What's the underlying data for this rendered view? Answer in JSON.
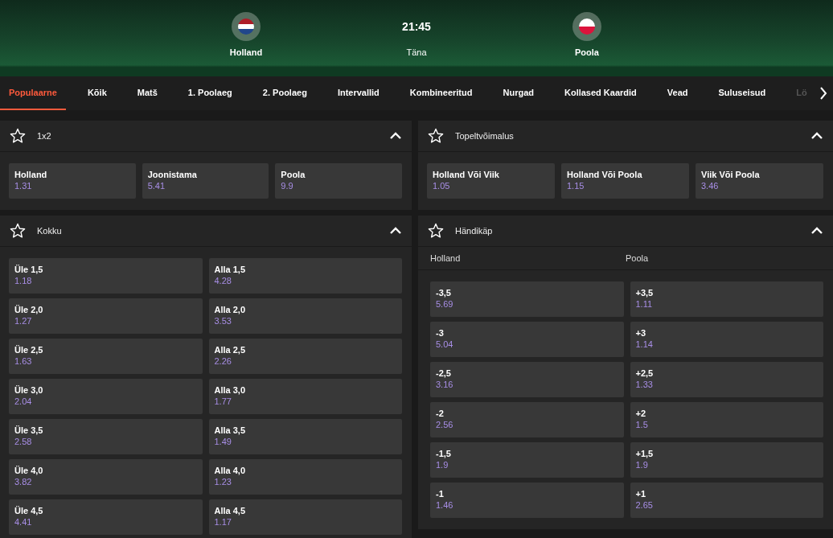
{
  "match": {
    "home": {
      "name": "Holland"
    },
    "time": "21:45",
    "day": "Täna",
    "away": {
      "name": "Poola"
    }
  },
  "tabs": [
    {
      "label": "Populaarne",
      "selected": true
    },
    {
      "label": "Kõik",
      "selected": false
    },
    {
      "label": "Matš",
      "selected": false
    },
    {
      "label": "1. Poolaeg",
      "selected": false
    },
    {
      "label": "2. Poolaeg",
      "selected": false
    },
    {
      "label": "Intervallid",
      "selected": false
    },
    {
      "label": "Kombineeritud",
      "selected": false
    },
    {
      "label": "Nurgad",
      "selected": false
    },
    {
      "label": "Kollased Kaardid",
      "selected": false
    },
    {
      "label": "Vead",
      "selected": false
    },
    {
      "label": "Suluseisud",
      "selected": false
    },
    {
      "label": "Lö",
      "selected": false,
      "faded": true
    }
  ],
  "columns": [
    [
      {
        "title": "1x2",
        "expanded": true,
        "kind": "row",
        "outcomes": [
          {
            "label": "Holland",
            "odds": "1.31"
          },
          {
            "label": "Joonistama",
            "odds": "5.41"
          },
          {
            "label": "Poola",
            "odds": "9.9"
          }
        ]
      },
      {
        "title": "Kokku",
        "expanded": true,
        "kind": "pairs",
        "outcomes": [
          {
            "label": "Üle 1,5",
            "odds": "1.18"
          },
          {
            "label": "Alla 1,5",
            "odds": "4.28"
          },
          {
            "label": "Üle 2,0",
            "odds": "1.27"
          },
          {
            "label": "Alla 2,0",
            "odds": "3.53"
          },
          {
            "label": "Üle 2,5",
            "odds": "1.63"
          },
          {
            "label": "Alla 2,5",
            "odds": "2.26"
          },
          {
            "label": "Üle 3,0",
            "odds": "2.04"
          },
          {
            "label": "Alla 3,0",
            "odds": "1.77"
          },
          {
            "label": "Üle 3,5",
            "odds": "2.58"
          },
          {
            "label": "Alla 3,5",
            "odds": "1.49"
          },
          {
            "label": "Üle 4,0",
            "odds": "3.82"
          },
          {
            "label": "Alla 4,0",
            "odds": "1.23"
          },
          {
            "label": "Üle 4,5",
            "odds": "4.41"
          },
          {
            "label": "Alla 4,5",
            "odds": "1.17"
          }
        ]
      }
    ],
    [
      {
        "title": "Topeltvõimalus",
        "expanded": true,
        "kind": "row",
        "outcomes": [
          {
            "label": "Holland Või Viik",
            "odds": "1.05"
          },
          {
            "label": "Holland Või Poola",
            "odds": "1.15"
          },
          {
            "label": "Viik Või Poola",
            "odds": "3.46"
          }
        ]
      },
      {
        "title": "Händikäp",
        "expanded": true,
        "kind": "pairs",
        "headings": [
          "Holland",
          "Poola"
        ],
        "outcomes": [
          {
            "label": "-3,5",
            "odds": "5.69"
          },
          {
            "label": "+3,5",
            "odds": "1.11"
          },
          {
            "label": "-3",
            "odds": "5.04"
          },
          {
            "label": "+3",
            "odds": "1.14"
          },
          {
            "label": "-2,5",
            "odds": "3.16"
          },
          {
            "label": "+2,5",
            "odds": "1.33"
          },
          {
            "label": "-2",
            "odds": "2.56"
          },
          {
            "label": "+2",
            "odds": "1.5"
          },
          {
            "label": "-1,5",
            "odds": "1.9"
          },
          {
            "label": "+1,5",
            "odds": "1.9"
          },
          {
            "label": "-1",
            "odds": "1.46"
          },
          {
            "label": "+1",
            "odds": "2.65"
          }
        ]
      }
    ]
  ]
}
